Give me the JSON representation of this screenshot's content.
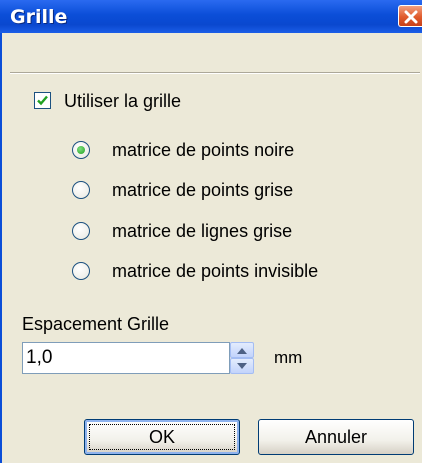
{
  "window": {
    "title": "Grille"
  },
  "grid_option": {
    "use_grid_label": "Utiliser la grille",
    "checked": true
  },
  "grid_styles": [
    {
      "label": "matrice de points noire",
      "selected": true
    },
    {
      "label": "matrice de points grise",
      "selected": false
    },
    {
      "label": "matrice de lignes grise",
      "selected": false
    },
    {
      "label": "matrice de points invisible",
      "selected": false
    }
  ],
  "spacing": {
    "label": "Espacement Grille",
    "value": "1,0",
    "unit": "mm"
  },
  "buttons": {
    "ok_label": "OK",
    "cancel_label": "Annuler"
  },
  "icons": {
    "close": "close-icon",
    "checkmark": "checkmark-icon",
    "spin_up": "arrow-up-icon",
    "spin_down": "arrow-down-icon"
  },
  "colors": {
    "titlebar": "#0b4ed8",
    "dialog_bg": "#ece9d8",
    "close_button": "#e05a2c",
    "check": "#21a121"
  }
}
